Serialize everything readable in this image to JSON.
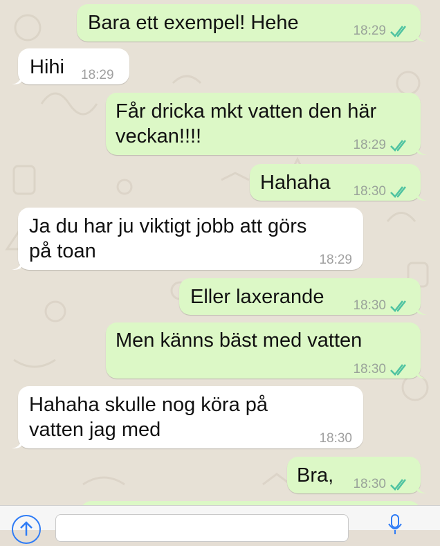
{
  "messages": [
    {
      "text": "Bara ett exempel! Hehe",
      "time": "18:29",
      "direction": "out",
      "status_icon": "double-check-icon"
    },
    {
      "text": "Hihi",
      "time": "18:29",
      "direction": "in"
    },
    {
      "text": "Får dricka mkt vatten den här veckan!!!!",
      "line1": "Får dricka mkt vatten den här",
      "line2": "veckan!!!!",
      "time": "18:29",
      "direction": "out",
      "status_icon": "double-check-icon"
    },
    {
      "text": "Hahaha",
      "time": "18:30",
      "direction": "out",
      "status_icon": "double-check-icon"
    },
    {
      "text": "Ja du har ju viktigt jobb att görs på toan",
      "line1": "Ja du har ju viktigt jobb att görs",
      "line2": "på toan",
      "time": "18:29",
      "direction": "in"
    },
    {
      "text": "Eller laxerande",
      "time": "18:30",
      "direction": "out",
      "status_icon": "double-check-icon"
    },
    {
      "text": "Men känns bäst med vatten",
      "time": "18:30",
      "direction": "out",
      "status_icon": "double-check-icon"
    },
    {
      "text": "Hahaha skulle nog köra på vatten jag med",
      "line1": "Hahaha skulle nog köra på",
      "line2": "vatten jag med",
      "time": "18:30",
      "direction": "in"
    },
    {
      "text": "Bra,",
      "time": "18:30",
      "direction": "out",
      "status_icon": "double-check-icon"
    }
  ],
  "input_bar": {
    "placeholder": "",
    "value": ""
  },
  "colors": {
    "outgoing": "#dcf8c6",
    "incoming": "#ffffff",
    "tick": "#4fc3a1",
    "accent": "#2f7cf6"
  }
}
